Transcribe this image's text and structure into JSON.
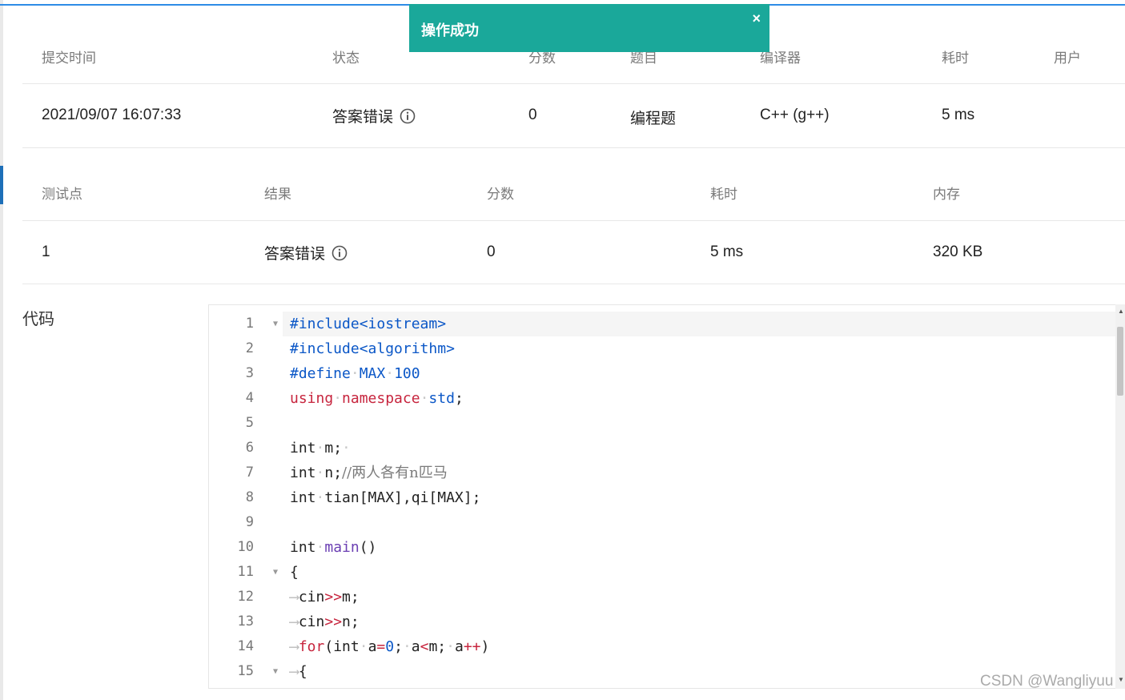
{
  "toast": {
    "message": "操作成功",
    "close": "×"
  },
  "submission": {
    "headers": [
      "提交时间",
      "状态",
      "分数",
      "题目",
      "编译器",
      "耗时",
      "用户"
    ],
    "row": {
      "time": "2021/09/07 16:07:33",
      "status": "答案错误",
      "score": "0",
      "problem": "编程题",
      "compiler": "C++ (g++)",
      "elapsed": "5 ms"
    }
  },
  "testcases": {
    "headers": [
      "测试点",
      "结果",
      "分数",
      "耗时",
      "内存"
    ],
    "row": {
      "id": "1",
      "result": "答案错误",
      "score": "0",
      "elapsed": "5 ms",
      "memory": "320 KB"
    }
  },
  "code_section": {
    "label": "代码"
  },
  "code_lines": [
    {
      "n": "1",
      "fold": true
    },
    {
      "n": "2"
    },
    {
      "n": "3"
    },
    {
      "n": "4"
    },
    {
      "n": "5"
    },
    {
      "n": "6"
    },
    {
      "n": "7"
    },
    {
      "n": "8"
    },
    {
      "n": "9"
    },
    {
      "n": "10"
    },
    {
      "n": "11",
      "fold": true
    },
    {
      "n": "12"
    },
    {
      "n": "13"
    },
    {
      "n": "14"
    },
    {
      "n": "15",
      "fold": true
    }
  ],
  "code_text": {
    "l1": "#include<iostream>",
    "l2": "#include<algorithm>",
    "l3_kw": "#define",
    "l3_name": "MAX",
    "l3_val": "100",
    "l4_using": "using",
    "l4_ns": "namespace",
    "l4_std": "std",
    "l4_semi": ";",
    "int": "int",
    "l6_rest": "m;",
    "l7_rest": "n;",
    "l7_comment": "//两人各有n匹马",
    "l8_rest": "tian[MAX],qi[MAX];",
    "l10_main": "main",
    "l10_paren": "()",
    "brace_open": "{",
    "cin": "cin",
    "shift": ">>",
    "l12_var": "m;",
    "l13_var": "n;",
    "for": "for",
    "l14_a": "(",
    "l14_b": "a",
    "eq": "=",
    "zero": "0",
    "l14_c": ";",
    "l14_d": "a",
    "lt": "<",
    "l14_e": "m;",
    "l14_f": "a",
    "inc": "++",
    "l14_g": ")"
  },
  "watermark": "CSDN @Wangliyuu",
  "colors": {
    "accent_blue": "#2e8ce6",
    "toast_bg": "#1aa89a",
    "error_green": "#1aa31a",
    "keyword_red": "#c7253e",
    "directive_blue": "#0b57c7",
    "function_purple": "#6b3fb3"
  }
}
